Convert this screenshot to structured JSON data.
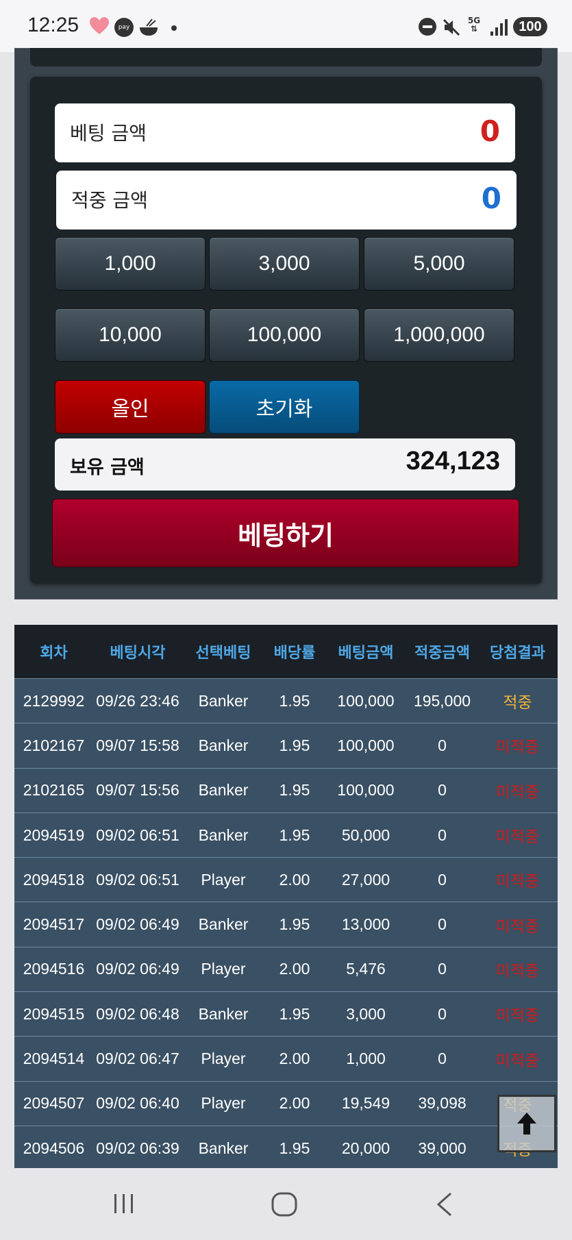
{
  "status_bar": {
    "time": "12:25",
    "battery": "100",
    "network": "5G",
    "pay_label": "pay"
  },
  "bet_panel": {
    "bet_amount_label": "베팅 금액",
    "bet_amount_value": "0",
    "win_amount_label": "적중 금액",
    "win_amount_value": "0",
    "chips": [
      "1,000",
      "3,000",
      "5,000",
      "10,000",
      "100,000",
      "1,000,000"
    ],
    "allin_label": "올인",
    "reset_label": "초기화",
    "balance_label": "보유 금액",
    "balance_value": "324,123",
    "bet_button_label": "베팅하기",
    "colors": {
      "bet_value": "#d0211f",
      "win_value": "#1f6fd1",
      "bet_button": "#a00024",
      "allin": "#b00000",
      "reset": "#08609a"
    }
  },
  "history": {
    "headers": [
      "회차",
      "베팅시각",
      "선택베팅",
      "배당률",
      "베팅금액",
      "적중금액",
      "당첨결과"
    ],
    "rows": [
      [
        "2129992",
        "09/26 23:46",
        "Banker",
        "1.95",
        "100,000",
        "195,000",
        "적중"
      ],
      [
        "2102167",
        "09/07 15:58",
        "Banker",
        "1.95",
        "100,000",
        "0",
        "미적중"
      ],
      [
        "2102165",
        "09/07 15:56",
        "Banker",
        "1.95",
        "100,000",
        "0",
        "미적중"
      ],
      [
        "2094519",
        "09/02 06:51",
        "Banker",
        "1.95",
        "50,000",
        "0",
        "미적중"
      ],
      [
        "2094518",
        "09/02 06:51",
        "Player",
        "2.00",
        "27,000",
        "0",
        "미적중"
      ],
      [
        "2094517",
        "09/02 06:49",
        "Banker",
        "1.95",
        "13,000",
        "0",
        "미적중"
      ],
      [
        "2094516",
        "09/02 06:49",
        "Player",
        "2.00",
        "5,476",
        "0",
        "미적중"
      ],
      [
        "2094515",
        "09/02 06:48",
        "Banker",
        "1.95",
        "3,000",
        "0",
        "미적중"
      ],
      [
        "2094514",
        "09/02 06:47",
        "Player",
        "2.00",
        "1,000",
        "0",
        "미적중"
      ],
      [
        "2094507",
        "09/02 06:40",
        "Player",
        "2.00",
        "19,549",
        "39,098",
        "적중"
      ],
      [
        "2094506",
        "09/02 06:39",
        "Banker",
        "1.95",
        "20,000",
        "39,000",
        "적중"
      ]
    ],
    "colors": {
      "header_text": "#4fa8e8",
      "win": "#f0b43a",
      "lose": "#d11a1a"
    }
  },
  "icons": {
    "scroll_top": "arrow-up-icon",
    "nav": [
      "recent-apps-icon",
      "home-icon",
      "back-icon"
    ]
  }
}
